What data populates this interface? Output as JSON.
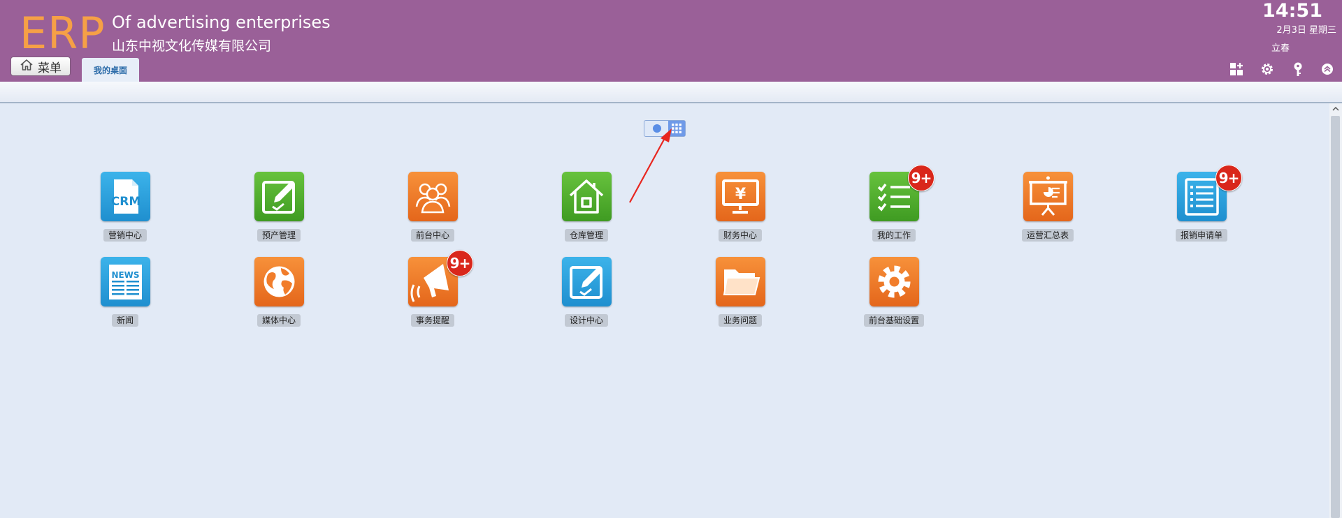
{
  "header": {
    "logo": "ERP",
    "company_en": "Of advertising enterprises",
    "company_cn": "山东中视文化传媒有限公司",
    "menu_label": "菜单",
    "tab_label": "我的桌面",
    "clock": {
      "time": "14:51",
      "date": "2月3日 星期三",
      "solar_term": "立春"
    },
    "icons": [
      "add-widget-icon",
      "gear-icon",
      "key-icon",
      "collapse-up-icon"
    ]
  },
  "view_toggle": {
    "modes": [
      "list",
      "grid"
    ],
    "active": "grid"
  },
  "apps": [
    {
      "label": "营销中心",
      "icon": "crm-icon",
      "color": "#2aa2de",
      "badge": ""
    },
    {
      "label": "预产管理",
      "icon": "edit-board-icon",
      "color": "#52b02f",
      "badge": ""
    },
    {
      "label": "前台中心",
      "icon": "people-icon",
      "color": "#f17d2b",
      "badge": ""
    },
    {
      "label": "仓库管理",
      "icon": "house-icon",
      "color": "#52b02f",
      "badge": ""
    },
    {
      "label": "财务中心",
      "icon": "yen-monitor-icon",
      "color": "#f17d2b",
      "badge": ""
    },
    {
      "label": "我的工作",
      "icon": "checklist-icon",
      "color": "#52b02f",
      "badge": "9+"
    },
    {
      "label": "运营汇总表",
      "icon": "presentation-icon",
      "color": "#f17d2b",
      "badge": ""
    },
    {
      "label": "报销申请单",
      "icon": "list-doc-icon",
      "color": "#2aa2de",
      "badge": "9+"
    },
    {
      "label": "新闻",
      "icon": "news-icon",
      "color": "#2aa2de",
      "badge": ""
    },
    {
      "label": "媒体中心",
      "icon": "globe-icon",
      "color": "#f17d2b",
      "badge": ""
    },
    {
      "label": "事务提醒",
      "icon": "megaphone-icon",
      "color": "#f17d2b",
      "badge": "9+"
    },
    {
      "label": "设计中心",
      "icon": "edit-board-icon",
      "color": "#2aa2de",
      "badge": ""
    },
    {
      "label": "业务问题",
      "icon": "folder-icon",
      "color": "#f17d2b",
      "badge": ""
    },
    {
      "label": "前台基础设置",
      "icon": "gear-icon",
      "color": "#f17d2b",
      "badge": ""
    }
  ]
}
